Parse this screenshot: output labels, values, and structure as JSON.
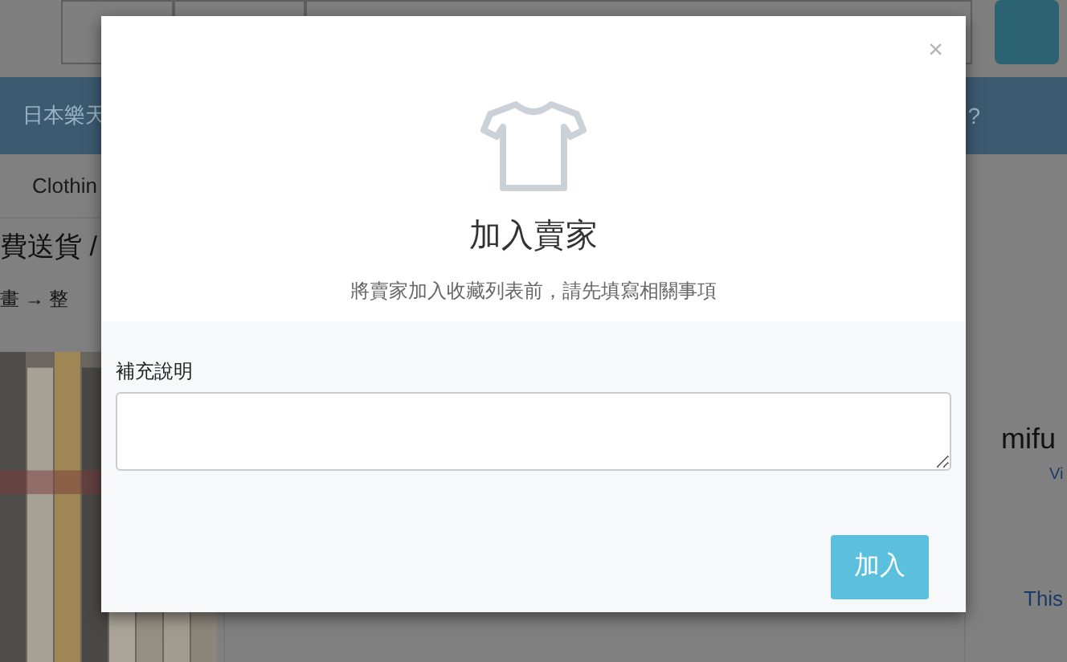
{
  "background": {
    "nav": {
      "item": "日本樂天",
      "help": "?"
    },
    "category": "Clothin",
    "heading": "費送貨 /",
    "breadcrumb": "畫 → 整",
    "seller": {
      "name": "mifu",
      "link": "Vi",
      "text": "This"
    }
  },
  "modal": {
    "close": "×",
    "title": "加入賣家",
    "subtitle": "將賣家加入收藏列表前，請先填寫相關事項",
    "field": {
      "label": "補充說明"
    },
    "submit": "加入"
  }
}
